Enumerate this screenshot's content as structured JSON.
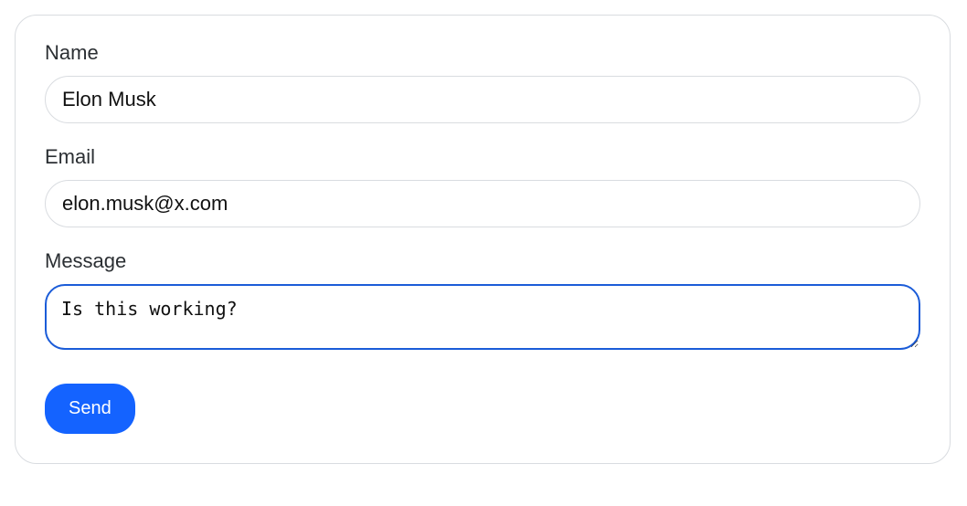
{
  "form": {
    "name": {
      "label": "Name",
      "value": "Elon Musk"
    },
    "email": {
      "label": "Email",
      "value": "elon.musk@x.com"
    },
    "message": {
      "label": "Message",
      "value": "Is this working?"
    },
    "submit": {
      "label": "Send"
    }
  }
}
